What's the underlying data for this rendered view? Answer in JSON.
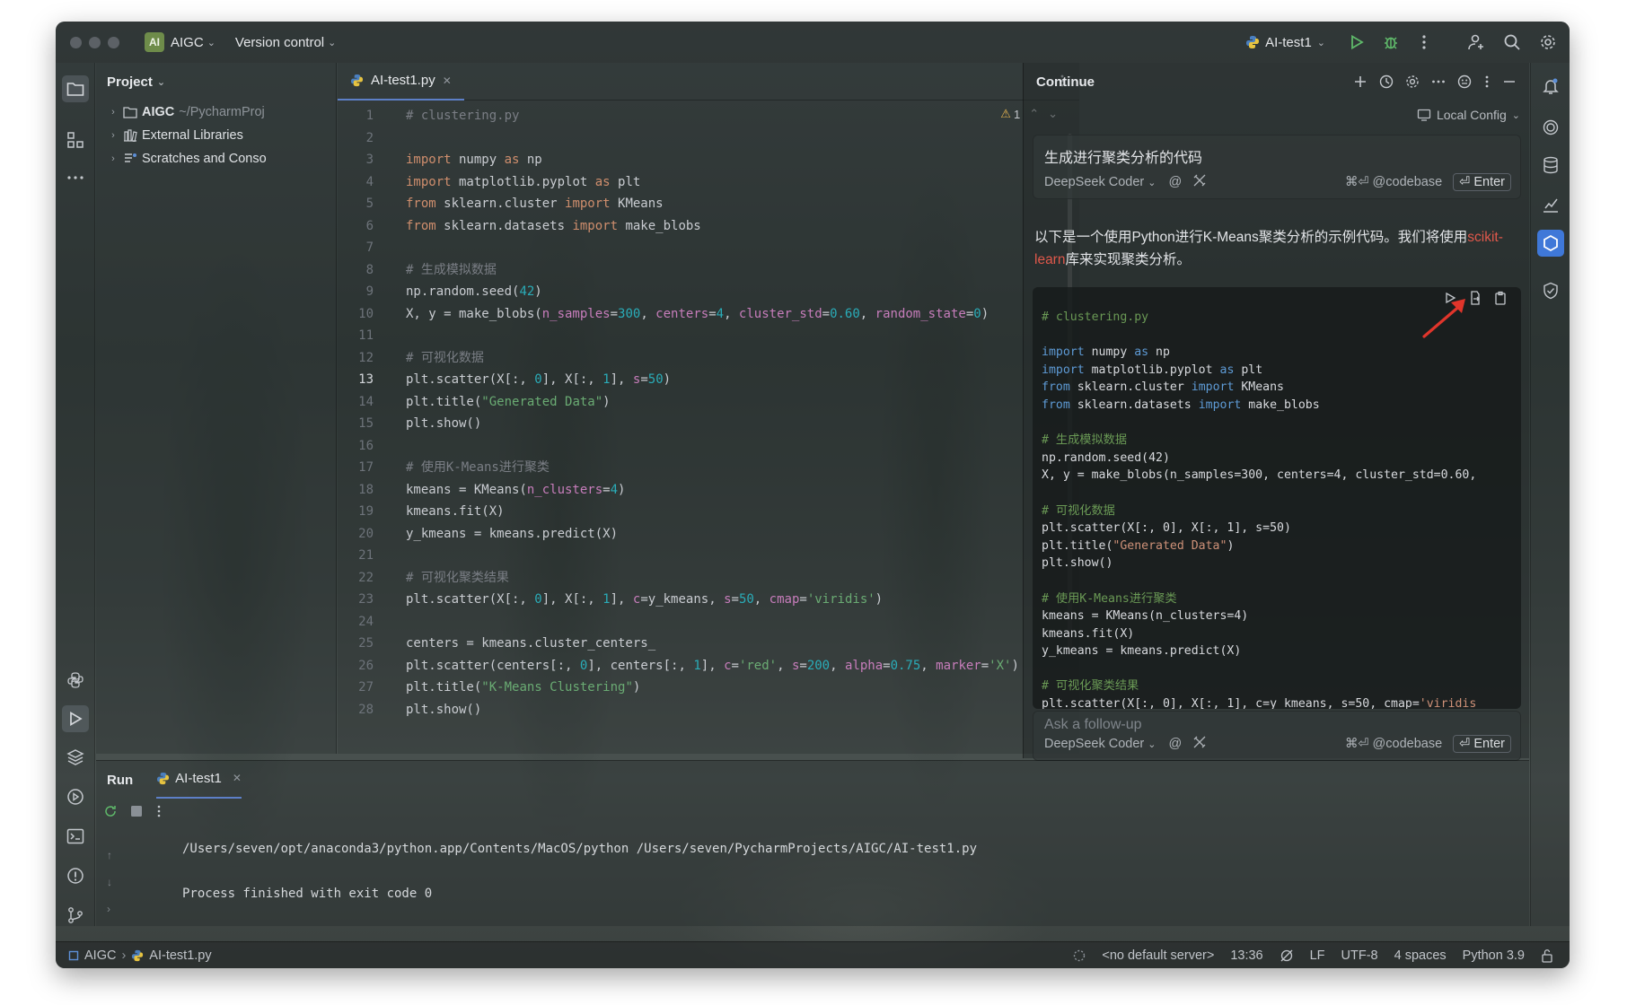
{
  "titlebar": {
    "project_badge": "AI",
    "project_name": "AIGC",
    "vcs": "Version control",
    "run_config": "AI-test1"
  },
  "project_panel": {
    "title": "Project",
    "items": [
      {
        "label": "AIGC",
        "path": "~/PycharmProj"
      },
      {
        "label": "External Libraries"
      },
      {
        "label": "Scratches and Conso"
      }
    ]
  },
  "editor": {
    "tab": "AI-test1.py",
    "warning_count": "1",
    "current_line": "13",
    "line_numbers": [
      "1",
      "2",
      "3",
      "4",
      "5",
      "6",
      "7",
      "8",
      "9",
      "10",
      "11",
      "12",
      "13",
      "14",
      "15",
      "16",
      "17",
      "18",
      "19",
      "20",
      "21",
      "22",
      "23",
      "24",
      "25",
      "26",
      "27",
      "28"
    ]
  },
  "continue_panel": {
    "title": "Continue",
    "config": "Local Config",
    "prompt": "生成进行聚类分析的代码",
    "model": "DeepSeek Coder",
    "codebase_hint": "⌘⏎ @codebase",
    "enter_label": "⏎ Enter",
    "answer_text_1": "以下是一个使用Python进行K-Means聚类分析的示例代码。我们将使用",
    "answer_link": "scikit-learn",
    "answer_text_2": "库来实现聚类分析。",
    "followup_placeholder": "Ask a follow-up"
  },
  "run_panel": {
    "title": "Run",
    "tab": "AI-test1",
    "output_cmd": "/Users/seven/opt/anaconda3/python.app/Contents/MacOS/python /Users/seven/PycharmProjects/AIGC/AI-test1.py",
    "output_exit": "Process finished with exit code 0"
  },
  "statusbar": {
    "project": "AIGC",
    "file": "AI-test1.py",
    "server": "<no default server>",
    "position": "13:36",
    "line_ending": "LF",
    "encoding": "UTF-8",
    "indent": "4 spaces",
    "interpreter": "Python 3.9"
  }
}
